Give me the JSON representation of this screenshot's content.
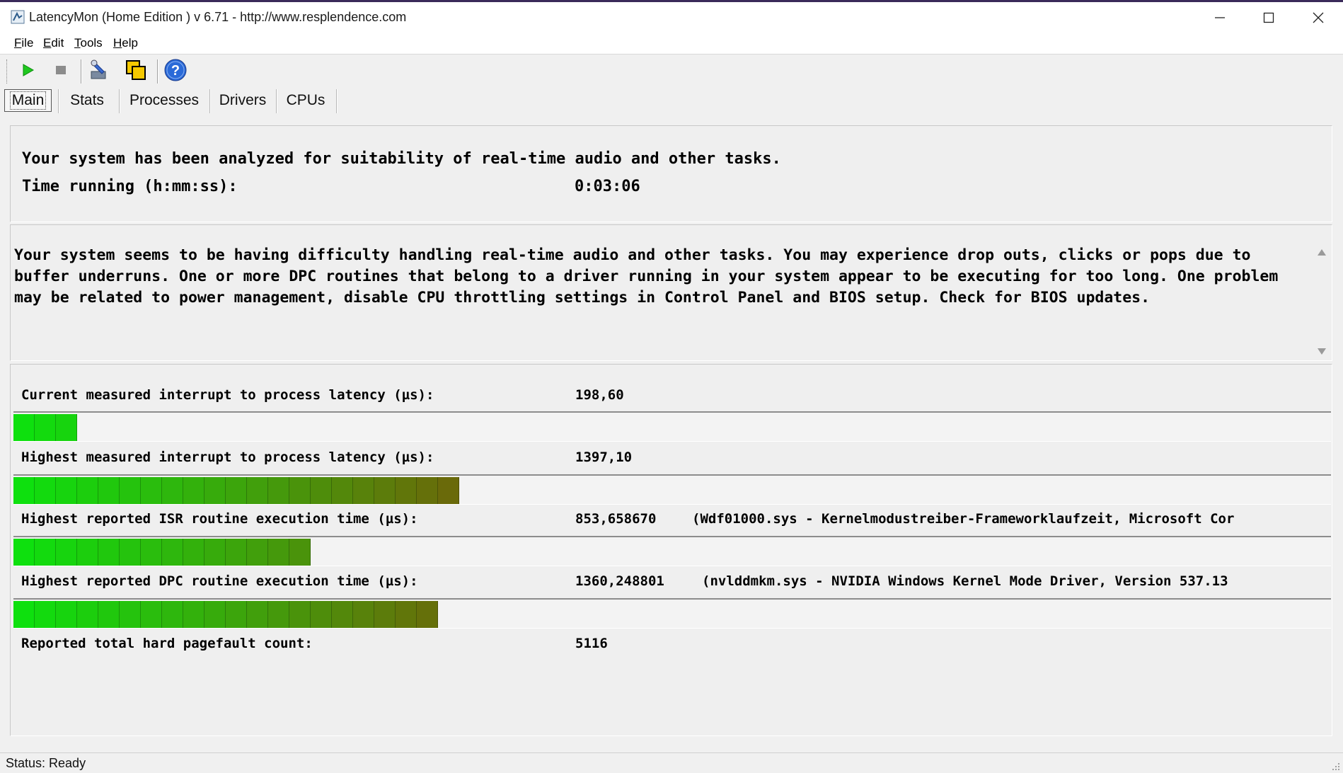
{
  "window": {
    "title": "LatencyMon  (Home Edition )  v 6.71 - http://www.resplendence.com",
    "controls": [
      "minimize-icon",
      "maximize-icon",
      "close-icon"
    ]
  },
  "menu": {
    "items": [
      {
        "label": "File",
        "accel": "F"
      },
      {
        "label": "Edit",
        "accel": "E"
      },
      {
        "label": "Tools",
        "accel": "T"
      },
      {
        "label": "Help",
        "accel": "H"
      }
    ]
  },
  "toolbar": {
    "buttons": [
      "play-icon",
      "stop-icon",
      "wrench-icon",
      "windows-icon",
      "help-icon"
    ]
  },
  "tabs": [
    {
      "label": "Main",
      "active": true
    },
    {
      "label": "Stats",
      "active": false
    },
    {
      "label": "Processes",
      "active": false
    },
    {
      "label": "Drivers",
      "active": false
    },
    {
      "label": "CPUs",
      "active": false
    }
  ],
  "summary": {
    "headline": "Your system has been analyzed for suitability of real-time audio and other tasks.",
    "time_label": "Time running (h:mm:ss):",
    "time_value": "0:03:06"
  },
  "advice": "Your system seems to be having difficulty handling real-time audio and other tasks. You may experience drop outs, clicks or pops due to buffer underruns. One or more DPC routines that belong to a driver running in your system appear to be executing for too long. One problem may be related to power management, disable CPU throttling settings in Control Panel and BIOS setup. Check for BIOS updates.",
  "metrics": [
    {
      "label": "Current measured interrupt to process latency (µs):",
      "value": "198,60",
      "detail": "",
      "bar_segments": 3
    },
    {
      "label": "Highest measured interrupt to process latency (µs):",
      "value": "1397,10",
      "detail": "",
      "bar_segments": 21
    },
    {
      "label": "Highest reported ISR routine execution time (µs):",
      "value": "853,658670",
      "detail": "(Wdf01000.sys - Kernelmodustreiber-Frameworklaufzeit, Microsoft Cor",
      "bar_segments": 14
    },
    {
      "label": "Highest reported DPC routine execution time (µs):",
      "value": "1360,248801",
      "detail": "(nvlddmkm.sys - NVIDIA Windows Kernel Mode Driver, Version 537.13",
      "bar_segments": 20
    },
    {
      "label": "Reported total hard pagefault count:",
      "value": "5116",
      "detail": "",
      "bar_segments": 0
    }
  ],
  "status": "Status: Ready",
  "colors": {
    "bar_start": "#0ee00e",
    "bar_end": "#6a6a0a"
  }
}
